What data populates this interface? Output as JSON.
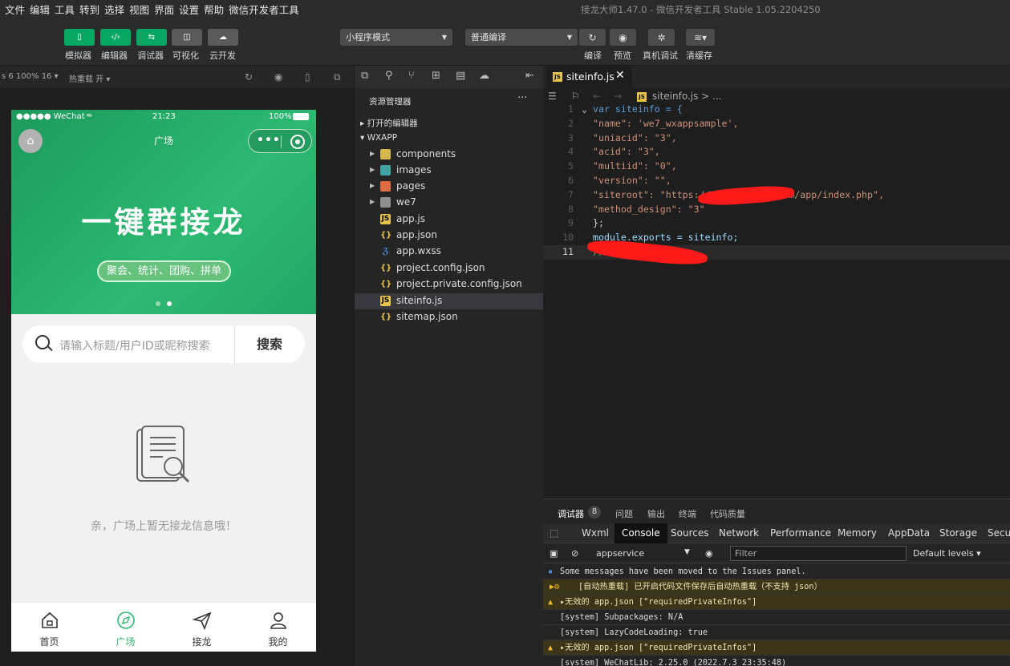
{
  "menubar": {
    "items": [
      "文件",
      "编辑",
      "工具",
      "转到",
      "选择",
      "视图",
      "界面",
      "设置",
      "帮助",
      "微信开发者工具"
    ],
    "title": "接龙大师1.47.0 - 微信开发者工具 Stable 1.05.2204250"
  },
  "toolbar": {
    "buttons": [
      {
        "label": "模拟器",
        "glyph": "▯"
      },
      {
        "label": "编辑器",
        "glyph": "‹/›"
      },
      {
        "label": "调试器",
        "glyph": "⇆"
      },
      {
        "label": "可视化",
        "glyph": "◫"
      },
      {
        "label": "云开发",
        "glyph": "☁"
      }
    ],
    "mode_select": "小程序模式",
    "compile_select": "普通编译",
    "actions": [
      "编译",
      "预览",
      "真机调试",
      "清缓存"
    ]
  },
  "simbar": {
    "device": "s 6 100% 16 ▾",
    "hotreload": "热重载 开 ▾"
  },
  "phone": {
    "status_carrier": "●●●●● WeChat",
    "status_time": "21:23",
    "status_battery": "100%",
    "nav_title": "广场",
    "banner_title": "一键群接龙",
    "banner_tags": "聚会、统计、团购、拼单",
    "search_placeholder": "请输入标题/用户ID或昵称搜索",
    "search_button": "搜索",
    "empty_text": "亲，广场上暂无接龙信息哦！",
    "tabs": [
      {
        "label": "首页",
        "icon": "home-icon"
      },
      {
        "label": "广场",
        "icon": "compass-icon"
      },
      {
        "label": "接龙",
        "icon": "send-icon"
      },
      {
        "label": "我的",
        "icon": "user-icon"
      }
    ],
    "active_tab": "广场"
  },
  "explorer": {
    "title": "资源管理器",
    "open_editors": "打开的编辑器",
    "project": "WXAPP",
    "items": [
      {
        "name": "components",
        "type": "folder",
        "color": "#d6b94a"
      },
      {
        "name": "images",
        "type": "folder",
        "color": "#3fa3a3"
      },
      {
        "name": "pages",
        "type": "folder",
        "color": "#e06c45"
      },
      {
        "name": "we7",
        "type": "folder",
        "color": "#8f8f8f"
      },
      {
        "name": "app.js",
        "type": "js",
        "color": "#e8c34a"
      },
      {
        "name": "app.json",
        "type": "json",
        "color": "#e8c34a"
      },
      {
        "name": "app.wxss",
        "type": "css",
        "color": "#4b8ad6"
      },
      {
        "name": "project.config.json",
        "type": "json",
        "color": "#e8c34a"
      },
      {
        "name": "project.private.config.json",
        "type": "json",
        "color": "#e8c34a"
      },
      {
        "name": "siteinfo.js",
        "type": "js",
        "color": "#e8c34a"
      },
      {
        "name": "sitemap.json",
        "type": "json",
        "color": "#e8c34a"
      }
    ],
    "selected": "siteinfo.js"
  },
  "editor": {
    "tab": "siteinfo.js",
    "breadcrumb": "siteinfo.js > ...",
    "lines": [
      {
        "n": "1",
        "text": "var siteinfo = {"
      },
      {
        "n": "2",
        "text": "\"name\": 'we7_wxappsample',"
      },
      {
        "n": "3",
        "text": "\"uniacid\": \"3\","
      },
      {
        "n": "4",
        "text": "\"acid\": \"3\","
      },
      {
        "n": "5",
        "text": "\"multiid\": \"0\","
      },
      {
        "n": "6",
        "text": "\"version\": \"\","
      },
      {
        "n": "7",
        "text": "\"siteroot\": \"https://demo.      .com/app/index.php\","
      },
      {
        "n": "8",
        "text": "\"method_design\": \"3\""
      },
      {
        "n": "9",
        "text": "};"
      },
      {
        "n": "10",
        "text": "module.exports = siteinfo;"
      },
      {
        "n": "11",
        "text": "//          .com"
      }
    ]
  },
  "devtools": {
    "tabs": [
      "调试器",
      "问题",
      "输出",
      "终端",
      "代码质量"
    ],
    "badge": "8",
    "panels": [
      "Wxml",
      "Console",
      "Sources",
      "Network",
      "Performance",
      "Memory",
      "AppData",
      "Storage",
      "Secur"
    ],
    "active_panel": "Console",
    "context": "appservice",
    "filter_placeholder": "Filter",
    "levels": "Default levels ▾",
    "logs": [
      {
        "text": "Some messages have been moved to the Issues panel.",
        "level": "info"
      },
      {
        "text": "[自动热重载] 已开启代码文件保存后自动热重载（不支持 json）",
        "level": "warn"
      },
      {
        "text": "▸无效的 app.json [\"requiredPrivateInfos\"]",
        "level": "warn"
      },
      {
        "text": "[system] Subpackages: N/A",
        "level": "log"
      },
      {
        "text": "[system] LazyCodeLoading: true",
        "level": "log"
      },
      {
        "text": "▸无效的 app.json [\"requiredPrivateInfos\"]",
        "level": "warn"
      },
      {
        "text": "[system] WeChatLib: 2.25.0 (2022.7.3 23:35:48)",
        "level": "log"
      }
    ]
  }
}
